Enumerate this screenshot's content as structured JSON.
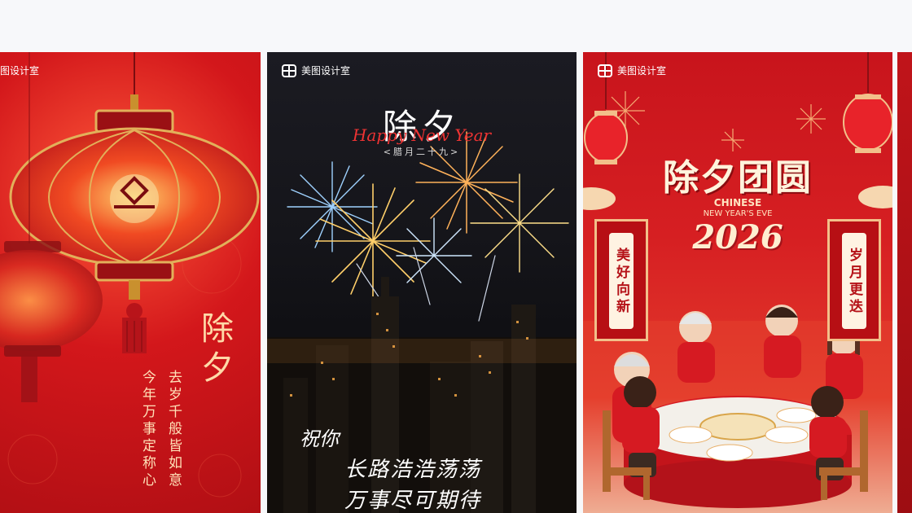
{
  "cards": [
    {
      "watermark": "图设计室",
      "title": "除夕",
      "lines": [
        "去岁千般皆如意",
        "今年万事定称心"
      ]
    },
    {
      "watermark": "美图设计室",
      "title": "除夕",
      "subtitle": "Happy New Year",
      "date": "<腊月二十九>",
      "wishes": [
        "祝你",
        "长路浩浩荡荡",
        "万事尽可期待"
      ]
    },
    {
      "watermark": "美图设计室",
      "title": "除夕团圆",
      "en_title_1": "CHINESE",
      "en_title_2": "NEW YEAR'S EVE",
      "year": "2026",
      "couplet_left": "美好向新",
      "couplet_right": "岁月更迭"
    }
  ],
  "colors": {
    "page_bg": "#f7f8fa",
    "festive_red": "#d3171b",
    "gold": "#f2c08a",
    "night": "#15151a"
  }
}
